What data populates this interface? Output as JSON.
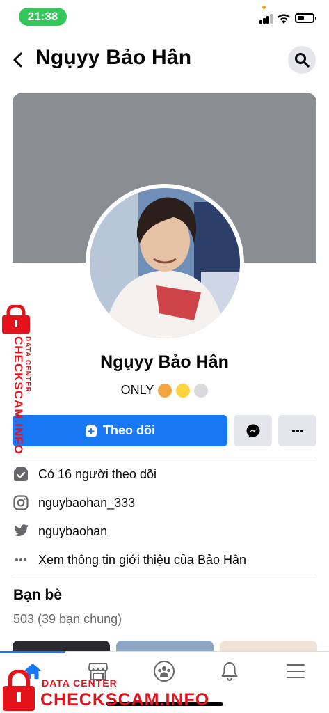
{
  "status_bar": {
    "time": "21:38"
  },
  "header": {
    "title": "Ngụyy Bảo Hân"
  },
  "profile": {
    "name": "Ngụyy Bảo Hân",
    "bio": "ONLY"
  },
  "actions": {
    "follow_label": "Theo dõi"
  },
  "info": {
    "followers": "Có 16 người theo dõi",
    "instagram": "nguybaohan_333",
    "twitter": "nguybaohan",
    "about": "Xem thông tin giới thiệu của Bảo Hân"
  },
  "friends": {
    "title": "Bạn bè",
    "count": "503 (39 bạn chung)"
  },
  "tabs": [
    "home",
    "marketplace",
    "groups",
    "notifications",
    "menu"
  ],
  "watermark": {
    "brand": "CHECKSCAM.INFO",
    "tagline": "DATA CENTER"
  },
  "colors": {
    "accent": "#1877f2",
    "cover": "#8a8d91",
    "watermark": "#e4131b"
  }
}
